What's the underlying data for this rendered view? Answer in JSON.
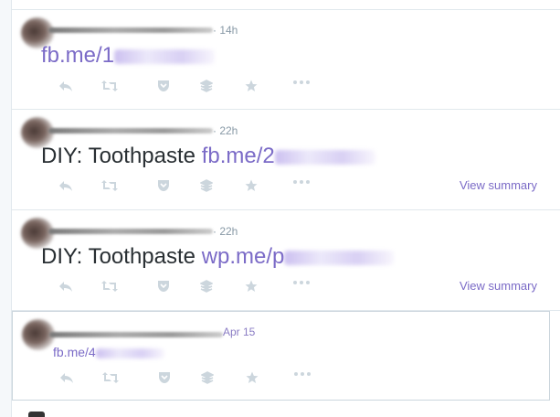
{
  "tweets": [
    {
      "time": "· 14h",
      "text": "",
      "link": "fb.me/1"
    },
    {
      "time": "· 22h",
      "text": "DIY: Toothpaste ",
      "link": "fb.me/2",
      "summary": "View summary"
    },
    {
      "time": "· 22h",
      "text": "DIY: Toothpaste ",
      "link": "wp.me/p",
      "summary": "View summary"
    },
    {
      "time": "Apr 15",
      "text": "",
      "link": "fb.me/4"
    }
  ],
  "actions": [
    "reply-icon",
    "retweet-icon",
    "pocket-icon",
    "buffer-icon",
    "favorite-icon",
    "more-icon"
  ],
  "colors": {
    "accent": "#7b6bc7",
    "muted": "#8899a6",
    "icon": "#ccd6dd",
    "border": "#e1e8ed"
  }
}
